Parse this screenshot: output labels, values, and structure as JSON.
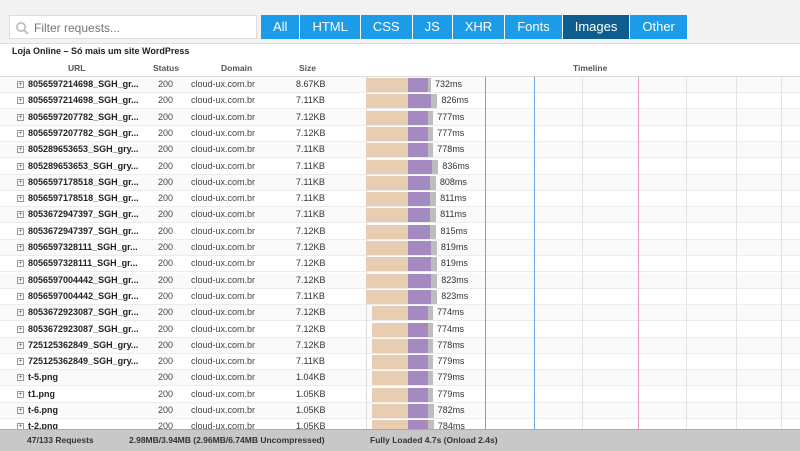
{
  "search": {
    "placeholder": "Filter requests..."
  },
  "tabs": [
    {
      "label": "All",
      "active": false
    },
    {
      "label": "HTML",
      "active": false
    },
    {
      "label": "CSS",
      "active": false
    },
    {
      "label": "JS",
      "active": false
    },
    {
      "label": "XHR",
      "active": false
    },
    {
      "label": "Fonts",
      "active": false
    },
    {
      "label": "Images",
      "active": true
    },
    {
      "label": "Other",
      "active": false
    }
  ],
  "page_title": "Loja Online – Só mais um site WordPress",
  "columns": {
    "url": "URL",
    "status": "Status",
    "domain": "Domain",
    "size": "Size",
    "timeline": "Timeline"
  },
  "requests": [
    {
      "url": "8056597214698_SGH_gr...",
      "status": "200",
      "domain": "cloud-ux.com.br",
      "size": "8.67KB",
      "time": "732ms"
    },
    {
      "url": "8056597214698_SGH_gr...",
      "status": "200",
      "domain": "cloud-ux.com.br",
      "size": "7.11KB",
      "time": "826ms"
    },
    {
      "url": "8056597207782_SGH_gr...",
      "status": "200",
      "domain": "cloud-ux.com.br",
      "size": "7.12KB",
      "time": "777ms"
    },
    {
      "url": "8056597207782_SGH_gr...",
      "status": "200",
      "domain": "cloud-ux.com.br",
      "size": "7.12KB",
      "time": "777ms"
    },
    {
      "url": "805289653653_SGH_gry...",
      "status": "200",
      "domain": "cloud-ux.com.br",
      "size": "7.11KB",
      "time": "778ms"
    },
    {
      "url": "805289653653_SGH_gry...",
      "status": "200",
      "domain": "cloud-ux.com.br",
      "size": "7.11KB",
      "time": "836ms"
    },
    {
      "url": "8056597178518_SGH_gr...",
      "status": "200",
      "domain": "cloud-ux.com.br",
      "size": "7.11KB",
      "time": "808ms"
    },
    {
      "url": "8056597178518_SGH_gr...",
      "status": "200",
      "domain": "cloud-ux.com.br",
      "size": "7.11KB",
      "time": "811ms"
    },
    {
      "url": "8053672947397_SGH_gr...",
      "status": "200",
      "domain": "cloud-ux.com.br",
      "size": "7.11KB",
      "time": "811ms"
    },
    {
      "url": "8053672947397_SGH_gr...",
      "status": "200",
      "domain": "cloud-ux.com.br",
      "size": "7.12KB",
      "time": "815ms"
    },
    {
      "url": "8056597328111_SGH_gr...",
      "status": "200",
      "domain": "cloud-ux.com.br",
      "size": "7.12KB",
      "time": "819ms"
    },
    {
      "url": "8056597328111_SGH_gr...",
      "status": "200",
      "domain": "cloud-ux.com.br",
      "size": "7.12KB",
      "time": "819ms"
    },
    {
      "url": "8056597004442_SGH_gr...",
      "status": "200",
      "domain": "cloud-ux.com.br",
      "size": "7.12KB",
      "time": "823ms"
    },
    {
      "url": "8056597004442_SGH_gr...",
      "status": "200",
      "domain": "cloud-ux.com.br",
      "size": "7.11KB",
      "time": "823ms"
    },
    {
      "url": "8053672923087_SGH_gr...",
      "status": "200",
      "domain": "cloud-ux.com.br",
      "size": "7.12KB",
      "time": "774ms"
    },
    {
      "url": "8053672923087_SGH_gr...",
      "status": "200",
      "domain": "cloud-ux.com.br",
      "size": "7.12KB",
      "time": "774ms"
    },
    {
      "url": "725125362849_SGH_gry...",
      "status": "200",
      "domain": "cloud-ux.com.br",
      "size": "7.12KB",
      "time": "778ms"
    },
    {
      "url": "725125362849_SGH_gry...",
      "status": "200",
      "domain": "cloud-ux.com.br",
      "size": "7.11KB",
      "time": "779ms"
    },
    {
      "url": "t-5.png",
      "status": "200",
      "domain": "cloud-ux.com.br",
      "size": "1.04KB",
      "time": "779ms"
    },
    {
      "url": "t1.png",
      "status": "200",
      "domain": "cloud-ux.com.br",
      "size": "1.05KB",
      "time": "779ms"
    },
    {
      "url": "t-6.png",
      "status": "200",
      "domain": "cloud-ux.com.br",
      "size": "1.05KB",
      "time": "782ms"
    },
    {
      "url": "t-2.png",
      "status": "200",
      "domain": "cloud-ux.com.br",
      "size": "1.05KB",
      "time": "784ms"
    }
  ],
  "footer": {
    "requests": "47/133 Requests",
    "transfer": "2.98MB/3.94MB  (2.96MB/6.74MB Uncompressed)",
    "loaded": "Fully Loaded 4.7s  (Onload 2.4s)"
  },
  "colors": {
    "tab": "#1b9be8",
    "tab_active": "#0d5e8e",
    "wait": "#e9cdb0",
    "receive": "#a58ac2",
    "blocked": "#bdbdbd",
    "dom_line": "#6fa8dc",
    "onload_line": "#e8a0c8"
  }
}
